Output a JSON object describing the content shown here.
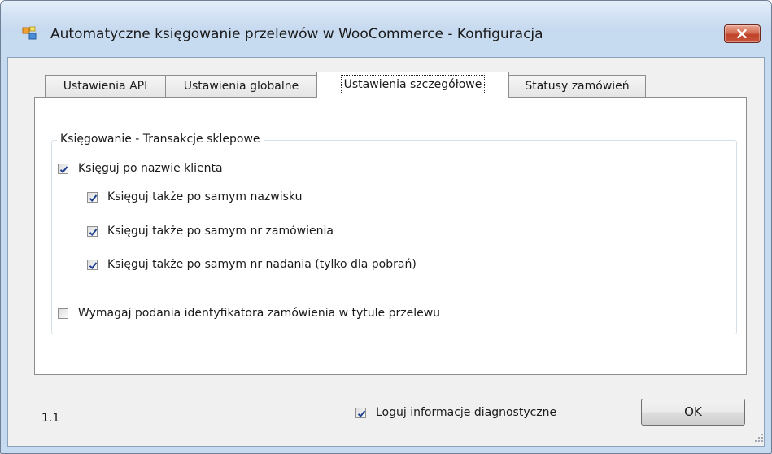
{
  "window": {
    "title": "Automatyczne księgowanie przelewów w WooCommerce - Konfiguracja"
  },
  "tabs": [
    "Ustawienia API",
    "Ustawienia globalne",
    "Ustawienia szczegółowe",
    "Statusy zamówień"
  ],
  "active_tab": "Ustawienia szczegółowe",
  "group": {
    "title": "Księgowanie - Transakcje sklepowe",
    "options": [
      {
        "label": "Księguj po nazwie klienta",
        "checked": true
      },
      {
        "label": "Księguj także po samym nazwisku",
        "checked": true
      },
      {
        "label": "Księguj także po samym nr zamówienia",
        "checked": true
      },
      {
        "label": "Księguj także po samym nr nadania (tylko dla pobrań)",
        "checked": true
      },
      {
        "label": "Wymagaj podania identyfikatora zamówienia w tytule przelewu",
        "checked": false
      }
    ]
  },
  "footer": {
    "version": "1.1",
    "diagnostic_label": "Loguj informacje diagnostyczne",
    "diagnostic_checked": true,
    "ok_label": "OK"
  },
  "colors": {
    "title_bar": "#d3e2f4",
    "close_button": "#c8563d",
    "check_mark": "#1f3f8f"
  },
  "icons": {
    "app": "window-app-icon",
    "close": "close-icon",
    "check": "check-icon",
    "grip": "resize-grip-icon"
  }
}
